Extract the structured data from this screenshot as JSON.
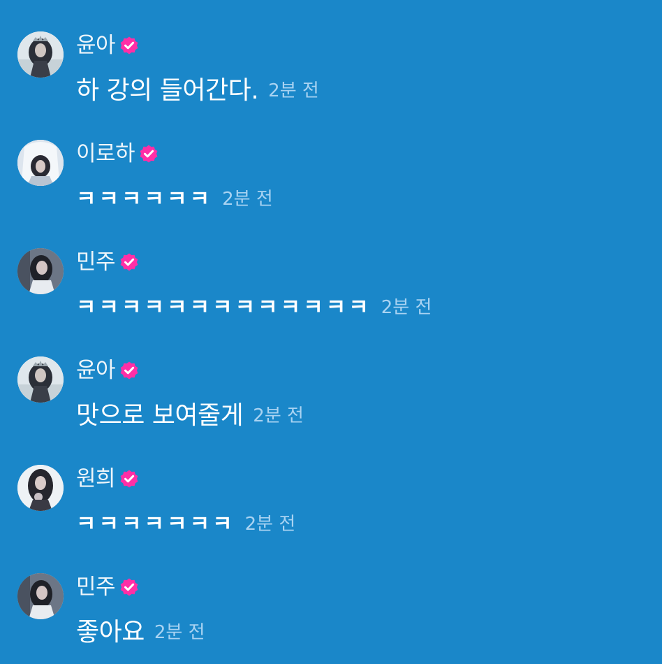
{
  "colors": {
    "background": "#1a87c9",
    "badge": "#ff2fa6",
    "timestamp": "#a9d3f2"
  },
  "messages": [
    {
      "author": "윤아",
      "verified": true,
      "text": "하 강의 들어간다.",
      "time": "2분 전",
      "avatar": "avatar-yuna"
    },
    {
      "author": "이로하",
      "verified": true,
      "text": "ㅋㅋㅋㅋㅋㅋ",
      "time": "2분 전",
      "avatar": "avatar-iroha"
    },
    {
      "author": "민주",
      "verified": true,
      "text": "ㅋㅋㅋㅋㅋㅋㅋㅋㅋㅋㅋㅋㅋ",
      "time": "2분 전",
      "avatar": "avatar-minju"
    },
    {
      "author": "윤아",
      "verified": true,
      "text": "맛으로 보여줄게",
      "time": "2분 전",
      "avatar": "avatar-yuna"
    },
    {
      "author": "원희",
      "verified": true,
      "text": "ㅋㅋㅋㅋㅋㅋㅋ",
      "time": "2분 전",
      "avatar": "avatar-wonhee"
    },
    {
      "author": "민주",
      "verified": true,
      "text": "좋아요",
      "time": "2분 전",
      "avatar": "avatar-minju"
    }
  ]
}
